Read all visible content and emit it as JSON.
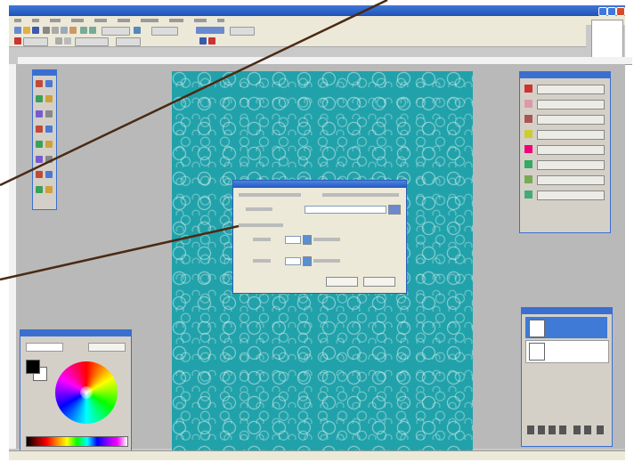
{
  "colors": {
    "canvas": "#21a2aa",
    "title_bar": "#2457c0",
    "panel": "#d4d0c8",
    "callout_line": "#4a2a14"
  },
  "icons": [
    "new-icon",
    "open-icon",
    "save-icon",
    "print-icon",
    "cut-icon",
    "copy-icon",
    "paste-icon",
    "undo-icon",
    "redo-icon",
    "zoom-icon",
    "brush-icon",
    "pencil-icon",
    "eraser-icon",
    "fill-icon",
    "text-icon",
    "crop-icon",
    "lasso-icon",
    "eyedropper-icon"
  ],
  "panels": {
    "tools": {
      "tool_count": 16
    },
    "scrapbook": {
      "button_count": 8
    },
    "colors": {
      "fg": "#000000",
      "bg": "#ffffff"
    },
    "layers": {
      "layer_count": 2
    }
  }
}
